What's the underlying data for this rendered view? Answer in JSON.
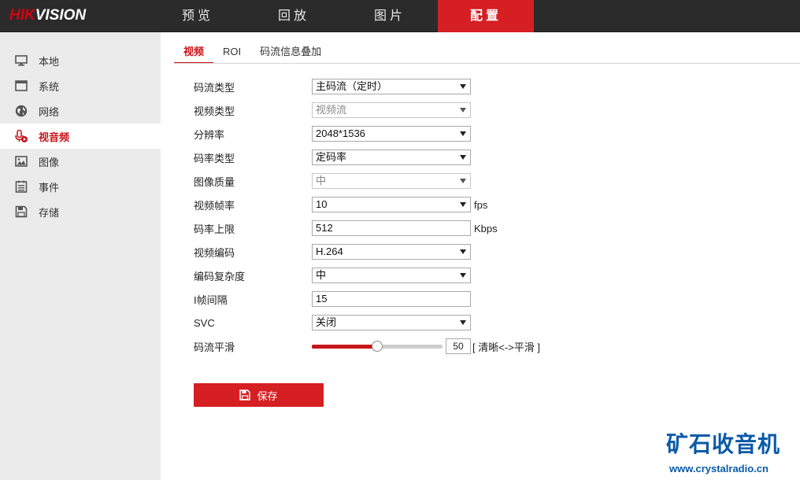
{
  "header": {
    "logo_hik": "HIK",
    "logo_vision": "VISION",
    "nav": [
      {
        "label": "预览"
      },
      {
        "label": "回放"
      },
      {
        "label": "图片"
      },
      {
        "label": "配置",
        "active": true
      }
    ]
  },
  "sidebar": {
    "items": [
      {
        "label": "本地",
        "icon": "monitor-icon"
      },
      {
        "label": "系统",
        "icon": "window-icon"
      },
      {
        "label": "网络",
        "icon": "globe-icon"
      },
      {
        "label": "视音频",
        "icon": "microphone-icon",
        "active": true
      },
      {
        "label": "图像",
        "icon": "image-icon"
      },
      {
        "label": "事件",
        "icon": "calendar-icon"
      },
      {
        "label": "存储",
        "icon": "floppy-icon"
      }
    ]
  },
  "tabs": [
    {
      "label": "视频",
      "active": true
    },
    {
      "label": "ROI"
    },
    {
      "label": "码流信息叠加"
    }
  ],
  "form": {
    "stream_type": {
      "label": "码流类型",
      "value": "主码流（定时）"
    },
    "video_type": {
      "label": "视频类型",
      "value": "视频流"
    },
    "resolution": {
      "label": "分辨率",
      "value": "2048*1536"
    },
    "bitrate_type": {
      "label": "码率类型",
      "value": "定码率"
    },
    "image_quality": {
      "label": "图像质量",
      "value": "中"
    },
    "frame_rate": {
      "label": "视频帧率",
      "value": "10",
      "unit": "fps"
    },
    "max_bitrate": {
      "label": "码率上限",
      "value": "512",
      "unit": "Kbps"
    },
    "video_encoding": {
      "label": "视频编码",
      "value": "H.264"
    },
    "encoding_complexity": {
      "label": "编码复杂度",
      "value": "中"
    },
    "i_frame_interval": {
      "label": "I帧间隔",
      "value": "15"
    },
    "svc": {
      "label": "SVC",
      "value": "关闭"
    },
    "smoothing": {
      "label": "码流平滑",
      "value": "50",
      "max": 100,
      "note": "[ 清晰<->平滑 ]"
    }
  },
  "save_label": "保存",
  "watermark": {
    "title": "矿石收音机",
    "url": "www.crystalradio.cn"
  },
  "colors": {
    "accent": "#d51f22",
    "topbar": "#2b2b2b",
    "sidebar": "#ebebeb",
    "watermark": "#0a5aa8"
  }
}
